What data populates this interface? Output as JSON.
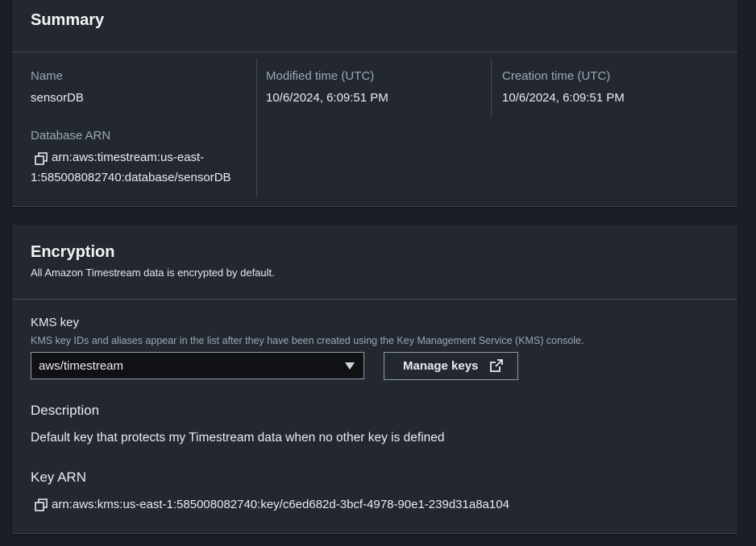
{
  "summary": {
    "title": "Summary",
    "name_label": "Name",
    "name_value": "sensorDB",
    "arn_label": "Database ARN",
    "arn_line1": "arn:aws:timestream:us-east-",
    "arn_line2": "1:585008082740:database/sensorDB",
    "modified_label": "Modified time (UTC)",
    "modified_value": "10/6/2024, 6:09:51 PM",
    "created_label": "Creation time (UTC)",
    "created_value": "10/6/2024, 6:09:51 PM"
  },
  "encryption": {
    "title": "Encryption",
    "subtitle": "All Amazon Timestream data is encrypted by default.",
    "kms_label": "KMS key",
    "kms_description": "KMS key IDs and aliases appear in the list after they have been created using the Key Management Service (KMS) console.",
    "kms_selected": "aws/timestream",
    "manage_keys_label": "Manage keys",
    "description_label": "Description",
    "description_value": "Default key that protects my Timestream data when no other key is defined",
    "key_arn_label": "Key ARN",
    "key_arn_value": "arn:aws:kms:us-east-1:585008082740:key/c6ed682d-3bcf-4978-90e1-239d31a8a104"
  },
  "icons": {
    "copy": "copy-icon",
    "external_link": "external-link-icon",
    "caret": "caret-down-icon"
  },
  "colors": {
    "background": "#1b1e24",
    "panel": "#232830",
    "label": "#9ba7b6",
    "text": "#e9ebed"
  }
}
